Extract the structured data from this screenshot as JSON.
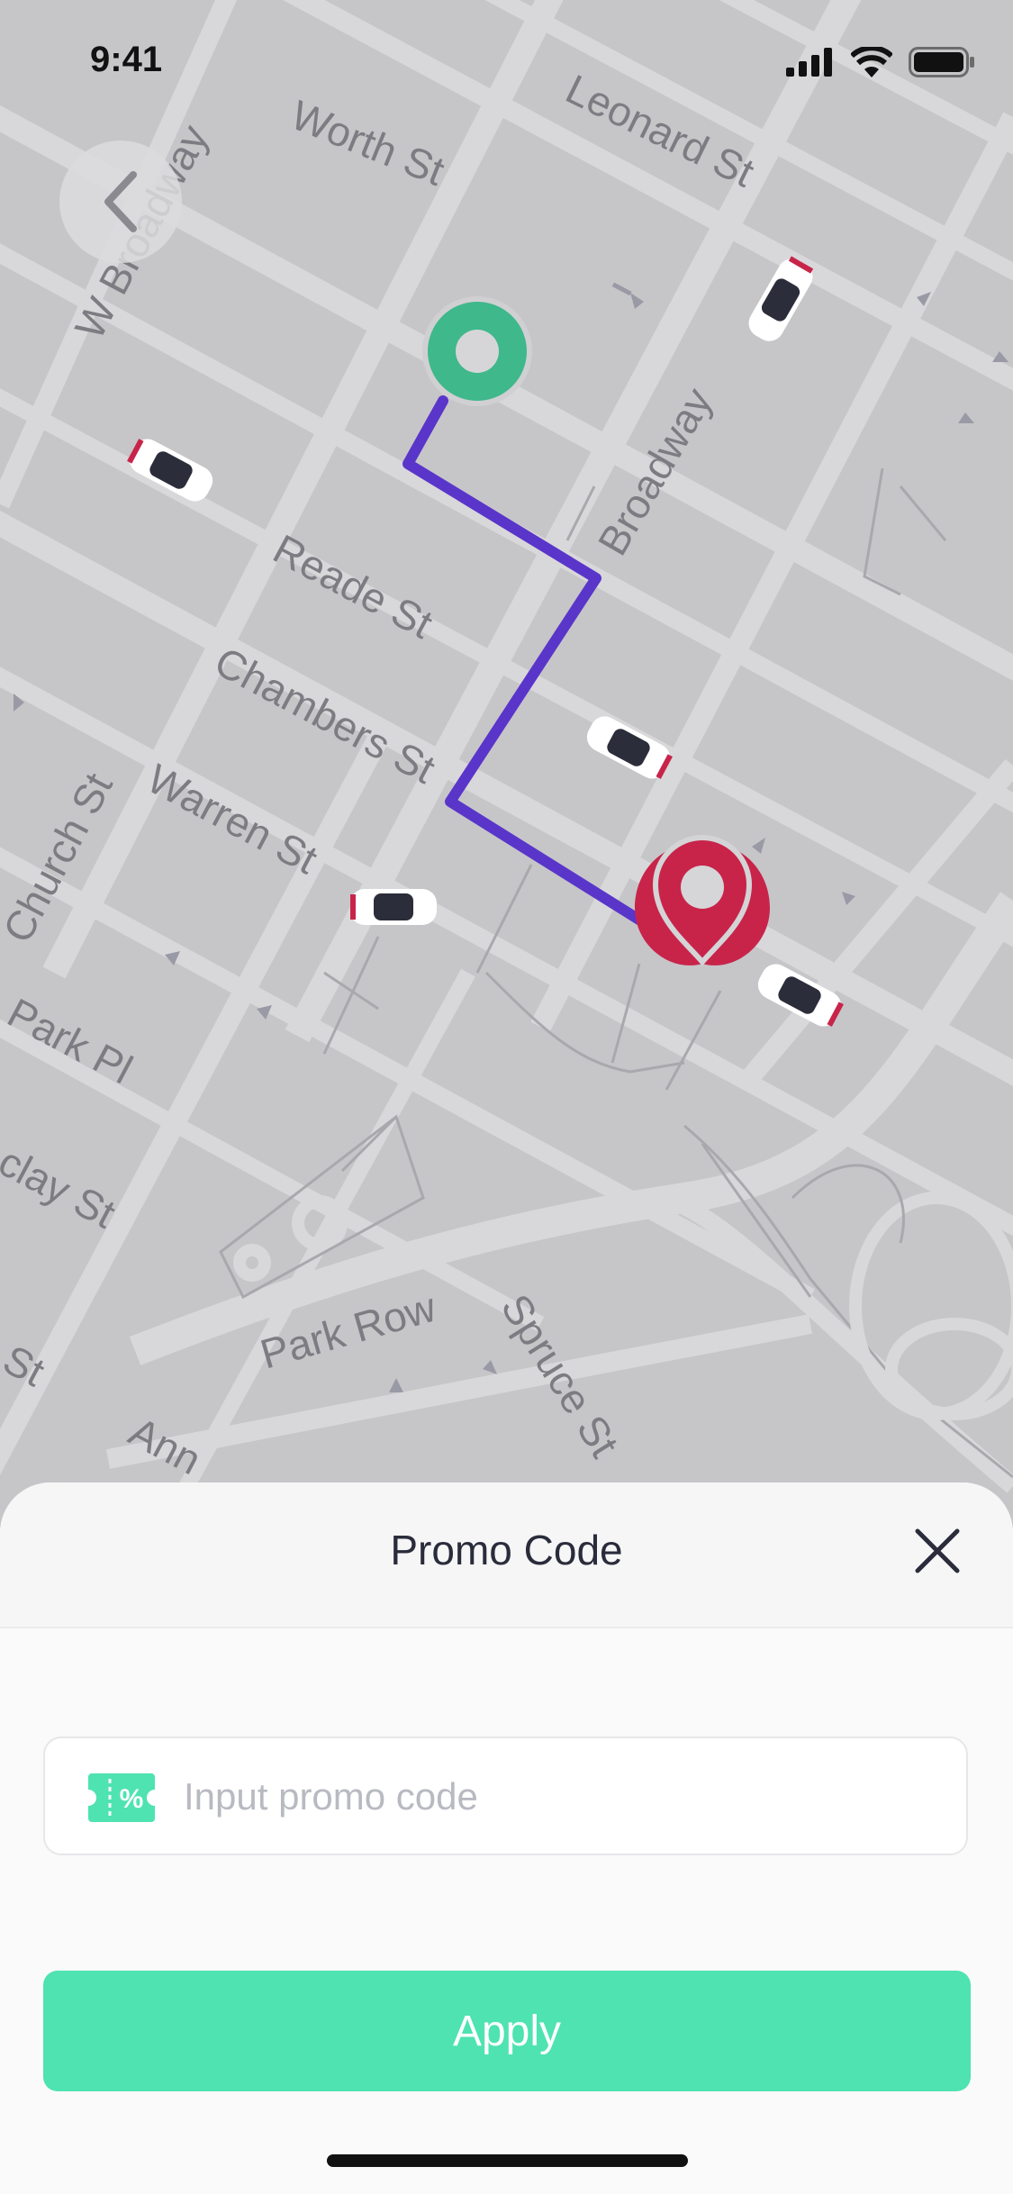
{
  "status_bar": {
    "time": "9:41"
  },
  "map": {
    "streets": [
      {
        "id": "worth",
        "label": "Worth St"
      },
      {
        "id": "leonard",
        "label": "Leonard St"
      },
      {
        "id": "w-broadway",
        "label": "W Broadway"
      },
      {
        "id": "broadway",
        "label": "Broadway"
      },
      {
        "id": "reade",
        "label": "Reade St"
      },
      {
        "id": "chambers",
        "label": "Chambers St"
      },
      {
        "id": "warren",
        "label": "Warren St"
      },
      {
        "id": "church",
        "label": "Church St"
      },
      {
        "id": "park-pl",
        "label": "Park Pl"
      },
      {
        "id": "barclay",
        "label": "clay St"
      },
      {
        "id": "park-row",
        "label": "Park Row"
      },
      {
        "id": "spruce",
        "label": "Spruce St"
      },
      {
        "id": "ann",
        "label": "Ann"
      },
      {
        "id": "st-left",
        "label": "St"
      }
    ],
    "colors": {
      "route": "#5a35c9",
      "origin": "#3fb88b",
      "destination": "#c8244a"
    }
  },
  "sheet": {
    "title": "Promo Code",
    "input_placeholder": "Input promo code",
    "input_value": "",
    "apply_label": "Apply",
    "colors": {
      "accent": "#4ee3b0"
    }
  },
  "icons": [
    "back-chevron-icon",
    "close-icon",
    "ticket-percent-icon",
    "signal-icon",
    "wifi-icon",
    "battery-icon",
    "car-icon",
    "origin-pin-icon",
    "destination-pin-icon"
  ]
}
